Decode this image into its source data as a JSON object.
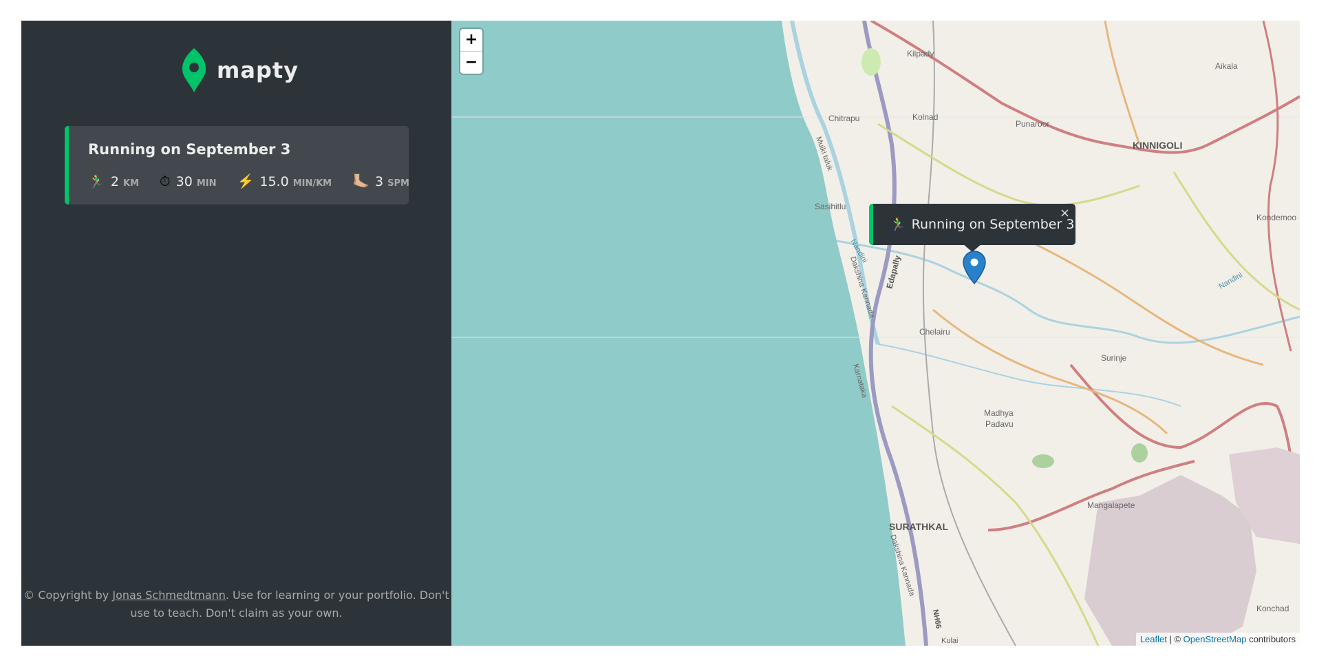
{
  "brand": {
    "name": "mapty",
    "logo_color": "#00c46a"
  },
  "workout": {
    "title": "Running on September 3",
    "type": "running",
    "accent": "#00c46a",
    "details": [
      {
        "icon": "🏃‍♂️",
        "icon_name": "runner-icon",
        "value": "2",
        "unit": "KM"
      },
      {
        "icon": "⏱",
        "icon_name": "stopwatch-icon",
        "value": "30",
        "unit": "MIN"
      },
      {
        "icon": "⚡️",
        "icon_name": "lightning-icon",
        "value": "15.0",
        "unit": "MIN/KM"
      },
      {
        "icon": "🦶🏼",
        "icon_name": "foot-icon",
        "value": "3",
        "unit": "SPM"
      }
    ]
  },
  "copyright": {
    "prefix": "© Copyright by ",
    "author": "Jonas Schmedtmann",
    "suffix": ". Use for learning or your portfolio. Don't use to teach. Don't claim as your own."
  },
  "map": {
    "zoom_in": "+",
    "zoom_out": "−",
    "popup": {
      "icon": "🏃‍♂️",
      "text": "Running on September 3",
      "close": "×"
    },
    "attribution": {
      "leaflet": "Leaflet",
      "sep": " | © ",
      "osm": "OpenStreetMap",
      "suffix": " contributors"
    },
    "labels": [
      "Kilpady",
      "Aikala",
      "Chitrapu",
      "Kolnad",
      "Punaroor",
      "KINNIGOLI",
      "Kondemoo",
      "Mulki taluk",
      "Sasihitlu",
      "Edapally",
      "Nandini",
      "Dakshina Kannada",
      "Chelairu",
      "Surinje",
      "Karnataka",
      "Madhya",
      "Padavu",
      "Mangalapete",
      "SURATHKAL",
      "NH66",
      "Konchad",
      "Kulai"
    ],
    "sea_color": "#8fcbc9",
    "land_color": "#f2efe9"
  }
}
